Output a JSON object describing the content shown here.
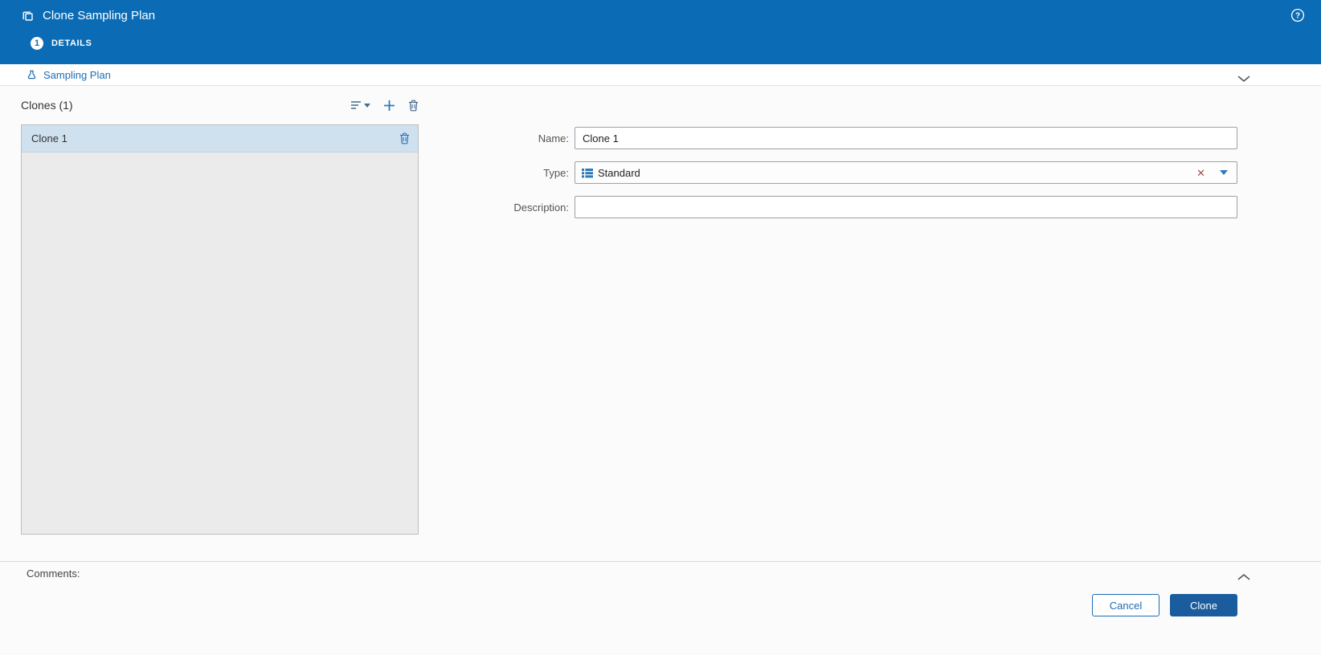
{
  "header": {
    "title": "Clone Sampling Plan",
    "step": {
      "number": "1",
      "label": "DETAILS"
    }
  },
  "breadcrumb": {
    "label": "Sampling Plan"
  },
  "clones_panel": {
    "title": "Clones (1)",
    "items": [
      {
        "label": "Clone 1",
        "selected": true
      }
    ]
  },
  "form": {
    "name": {
      "label": "Name:",
      "value": "Clone 1"
    },
    "type": {
      "label": "Type:",
      "value": "Standard"
    },
    "description": {
      "label": "Description:",
      "value": ""
    }
  },
  "comments": {
    "label": "Comments:"
  },
  "footer": {
    "cancel_label": "Cancel",
    "clone_label": "Clone"
  },
  "icons": {
    "header_left": "clone-copy-icon",
    "header_right": "help-icon",
    "breadcrumb": "sampling-plan-flask-icon",
    "toolbar": [
      "filter-icon",
      "add-icon",
      "trash-icon"
    ],
    "type_field": [
      "list-icon",
      "clear-x-icon",
      "dropdown-arrow-icon"
    ]
  },
  "colors": {
    "header_blue": "#0b6cb5",
    "accent_blue": "#1b6db2",
    "button_blue": "#1a5c9e",
    "selection_blue": "#cfe0ee",
    "list_bg": "#ebebeb"
  }
}
